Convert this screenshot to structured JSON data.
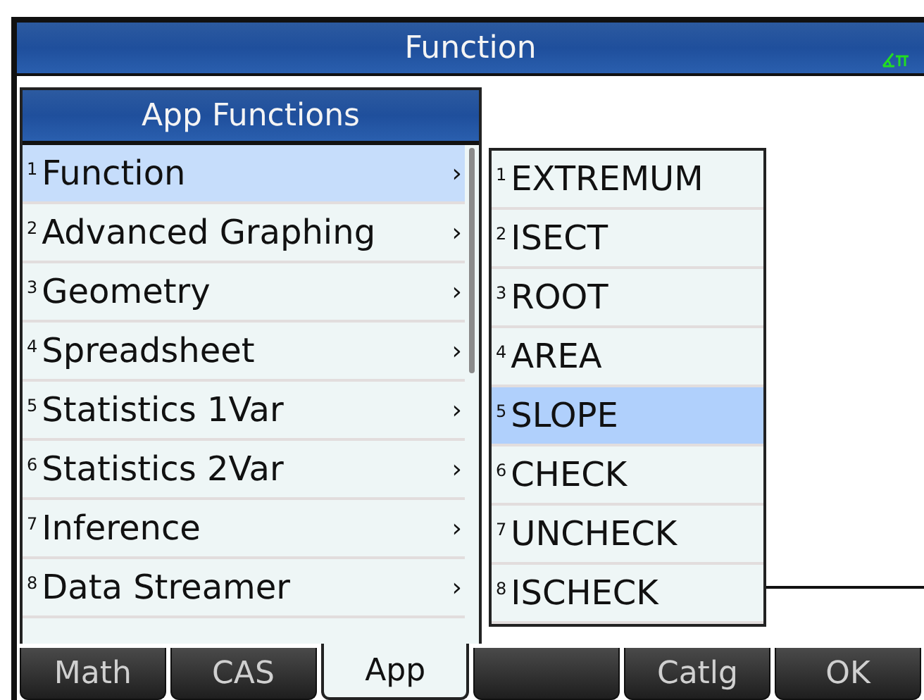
{
  "window": {
    "title": "Function"
  },
  "menu": {
    "title": "App Functions",
    "items": [
      {
        "number": "1",
        "label": "Function",
        "arrow": "›",
        "selected": true
      },
      {
        "number": "2",
        "label": "Advanced Graphing",
        "arrow": "›",
        "selected": false
      },
      {
        "number": "3",
        "label": "Geometry",
        "arrow": "›",
        "selected": false
      },
      {
        "number": "4",
        "label": "Spreadsheet",
        "arrow": "›",
        "selected": false
      },
      {
        "number": "5",
        "label": "Statistics 1Var",
        "arrow": "›",
        "selected": false
      },
      {
        "number": "6",
        "label": "Statistics 2Var",
        "arrow": "›",
        "selected": false
      },
      {
        "number": "7",
        "label": "Inference",
        "arrow": "›",
        "selected": false
      },
      {
        "number": "8",
        "label": "Data Streamer",
        "arrow": "›",
        "selected": false
      }
    ]
  },
  "submenu": {
    "items": [
      {
        "number": "1",
        "label": "EXTREMUM",
        "selected": false
      },
      {
        "number": "2",
        "label": "ISECT",
        "selected": false
      },
      {
        "number": "3",
        "label": "ROOT",
        "selected": false
      },
      {
        "number": "4",
        "label": "AREA",
        "selected": false
      },
      {
        "number": "5",
        "label": "SLOPE",
        "selected": true
      },
      {
        "number": "6",
        "label": "CHECK",
        "selected": false
      },
      {
        "number": "7",
        "label": "UNCHECK",
        "selected": false
      },
      {
        "number": "8",
        "label": "ISCHECK",
        "selected": false
      }
    ]
  },
  "softkeys": [
    {
      "label": "Math",
      "selected": false
    },
    {
      "label": "CAS",
      "selected": false
    },
    {
      "label": "App",
      "selected": true
    },
    {
      "selected": false
    },
    {
      "label": "Catlg",
      "selected": false
    },
    {
      "label": "OK",
      "selected": false
    }
  ]
}
